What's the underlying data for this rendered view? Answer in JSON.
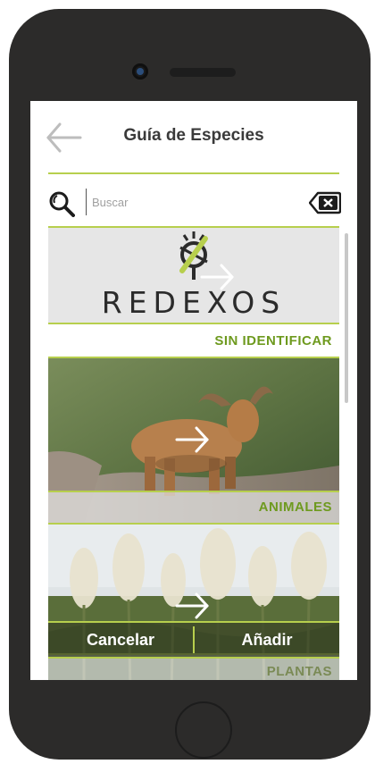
{
  "header": {
    "title": "Guía de Especies",
    "back_icon": "back-arrow-icon"
  },
  "search": {
    "placeholder": "Buscar",
    "value": "",
    "search_icon": "magnifier-icon",
    "clear_icon": "backspace-icon"
  },
  "brand": {
    "logo_text": "REDEXOS"
  },
  "categories": [
    {
      "label": "SIN IDENTIFICAR"
    },
    {
      "label": "ANIMALES"
    },
    {
      "label": "PLANTAS"
    }
  ],
  "actions": {
    "cancel_label": "Cancelar",
    "add_label": "Añadir"
  },
  "colors": {
    "accent": "#b7cf4d",
    "accent_dark": "#6e9a1f",
    "phone_body": "#2c2b2a"
  }
}
